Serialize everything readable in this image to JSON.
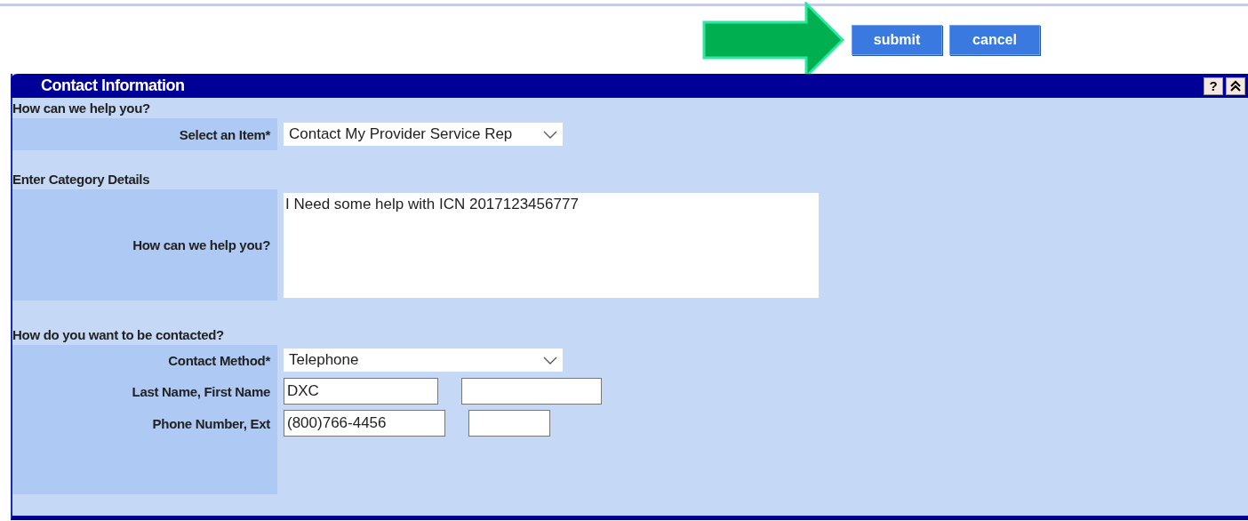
{
  "actions": {
    "buttons": [
      {
        "label": "submit"
      },
      {
        "label": "cancel"
      }
    ]
  },
  "panel": {
    "title": "Contact Information",
    "tools": [
      {
        "label": "?",
        "kind": "help"
      },
      {
        "kind": "collapse"
      }
    ]
  },
  "sections": [
    {
      "heading": "How can we help you?",
      "rows": [
        {
          "kind": "select",
          "label": "Select an Item*",
          "value": "Contact My Provider Service Rep"
        }
      ]
    },
    {
      "heading": "Enter Category Details",
      "rows": [
        {
          "kind": "textarea",
          "label": "How can we help you?",
          "value": "I Need some help with ICN 2017123456777"
        }
      ]
    },
    {
      "heading": "How do you want to be contacted?",
      "rows": [
        {
          "kind": "select",
          "label": "Contact Method*",
          "value": "Telephone"
        },
        {
          "kind": "pair",
          "label": "Last Name, First Name",
          "value": "DXC"
        },
        {
          "kind": "pair",
          "label": "Phone Number, Ext",
          "value": "(800)766-4456"
        }
      ]
    }
  ]
}
